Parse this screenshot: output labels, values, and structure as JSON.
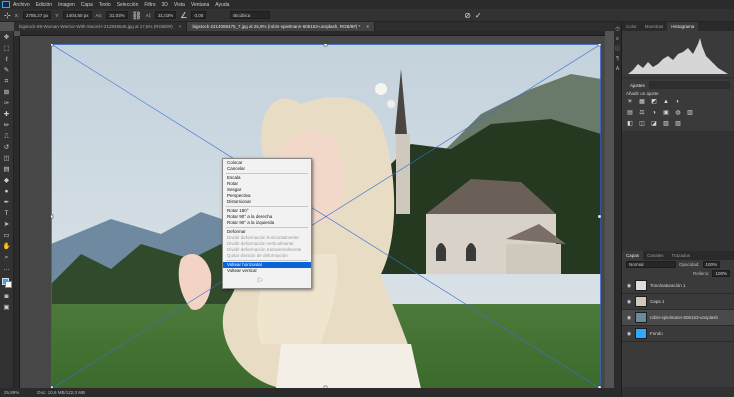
{
  "menubar": {
    "items": [
      "Archivo",
      "Edición",
      "Imagen",
      "Capa",
      "Texto",
      "Selección",
      "Filtro",
      "3D",
      "Vista",
      "Ventana",
      "Ayuda"
    ]
  },
  "options": {
    "x_label": "X:",
    "x_value": "2785,27 px",
    "y_label": "Y:",
    "y_value": "1404,50 px",
    "w_label": "An:",
    "w_value": "31,03%",
    "h_label": "Al:",
    "h_value": "31,03%",
    "angle_value": "0,00",
    "interp": "Bicúbica",
    "cancel_icon": "⊘",
    "commit_icon": "✓"
  },
  "tabs": [
    {
      "label": "bigstock-69-Woman-Warrior-With-Sword-I-212849546.jpg al 17,6% (RGB/8#)",
      "close": "×"
    },
    {
      "label": "bigstock-2214088475_7.jpg al 25,9% (robin-spielmann-606153-unsplash, RGB/8#) *",
      "close": "×"
    }
  ],
  "status": {
    "zoom": "25,89%",
    "doc": "Doc: 10,6 MB/122,3 MB"
  },
  "context_menu": {
    "items": [
      {
        "label": "Colocar",
        "state": "normal"
      },
      {
        "label": "Cancelar",
        "state": "normal"
      },
      {
        "sep": true
      },
      {
        "label": "Escala",
        "state": "normal"
      },
      {
        "label": "Rotar",
        "state": "normal"
      },
      {
        "label": "Sesgar",
        "state": "normal"
      },
      {
        "label": "Perspectiva",
        "state": "normal"
      },
      {
        "label": "Distorsionar",
        "state": "normal"
      },
      {
        "sep": true
      },
      {
        "label": "Rotar 180°",
        "state": "normal"
      },
      {
        "label": "Rotar 90° a la derecha",
        "state": "normal"
      },
      {
        "label": "Rotar 90° a la izquierda",
        "state": "normal"
      },
      {
        "sep": true
      },
      {
        "label": "Deformar",
        "state": "normal"
      },
      {
        "label": "Dividir deformación horizontalmente",
        "state": "disabled"
      },
      {
        "label": "Dividir deformación verticalmente",
        "state": "disabled"
      },
      {
        "label": "Dividir deformación transversalmente",
        "state": "disabled"
      },
      {
        "label": "Quitar división de deformación",
        "state": "disabled"
      },
      {
        "sep": true
      },
      {
        "label": "Voltear horizontal",
        "state": "highlighted"
      },
      {
        "label": "Voltear vertical",
        "state": "normal"
      }
    ]
  },
  "histogram_panel": {
    "tabs": [
      "Color",
      "Muestras",
      "Histograma"
    ],
    "active": "Histograma"
  },
  "adjust_panel": {
    "tab": "Ajustes",
    "title": "Añadir un ajuste",
    "icons_row1": [
      "☀",
      "▦",
      "◩",
      "▲",
      "◐"
    ],
    "icons_row2": [
      "▤",
      "⚖",
      "◑",
      "▣",
      "◍",
      "▥"
    ],
    "icons_row3": [
      "◧",
      "◫",
      "◪",
      "▧",
      "▨"
    ]
  },
  "layers_panel": {
    "tabs": [
      "Capas",
      "Canales",
      "Trazados"
    ],
    "active": "Capas",
    "blend": "Normal",
    "opacity_label": "Opacidad:",
    "opacity_value": "100%",
    "fill_label": "Relleno:",
    "fill_value": "100%",
    "layers": [
      {
        "name": "Tono/saturación 1",
        "thumb": "#dcdcdc",
        "selected": false
      },
      {
        "name": "Capa 1",
        "thumb": "#d0c8bc",
        "selected": false
      },
      {
        "name": "robin-spielmann-606153-unsplash",
        "thumb": "#6b8a9a",
        "selected": true
      },
      {
        "name": "Fondo",
        "thumb": "#31a8ff",
        "selected": false
      }
    ]
  },
  "colors": {
    "accent": "#31a8ff",
    "menu_highlight": "#0a64d8"
  }
}
